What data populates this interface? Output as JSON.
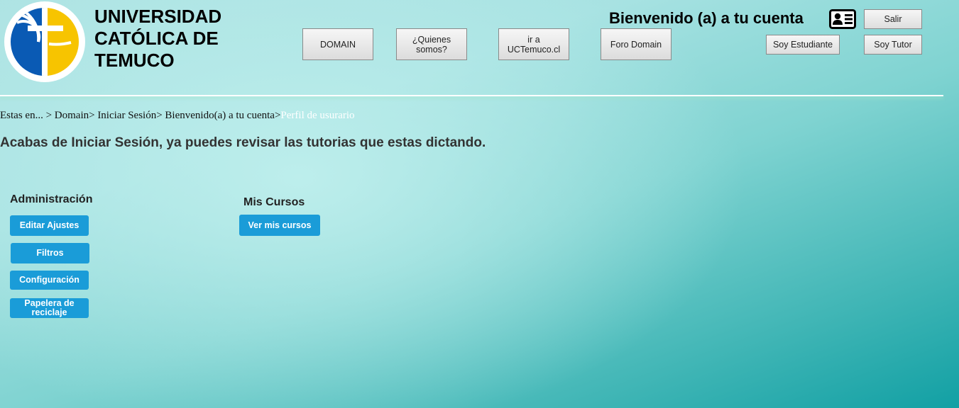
{
  "header": {
    "university_name_lines": [
      "UNIVERSIDAD",
      "CATÓLICA DE",
      "TEMUCO"
    ],
    "logo_icon": "university-shield-logo",
    "logo_colors": {
      "blue": "#0a5ab4",
      "yellow": "#f7c400",
      "white": "#ffffff"
    },
    "nav": {
      "domain": "DOMAIN",
      "quienes_line1": "¿Quienes",
      "quienes_line2": "somos?",
      "uctemuco_line1": "ir a",
      "uctemuco_line2": "UCTemuco.cl",
      "foro": "Foro Domain"
    },
    "welcome": "Bienvenido (a) a tu cuenta",
    "account_icon": "id-card-icon",
    "logout": "Salir",
    "student": "Soy Estudiante",
    "tutor": "Soy Tutor"
  },
  "breadcrumb": {
    "trail": "Estas en... > Domain> Iniciar Sesión> Bienvenido(a) a tu cuenta>",
    "current": "Perfil de usurario"
  },
  "main": {
    "headline": "Acabas de Iniciar Sesión, ya puedes revisar las tutorias que estas dictando."
  },
  "admin": {
    "title": "Administración",
    "edit_settings": "Editar Ajustes",
    "filters": "Filtros",
    "configuration": "Configuración",
    "recycle_line1": "Papelera de",
    "recycle_line2": "reciclaje"
  },
  "courses": {
    "title": "Mis Cursos",
    "view": "Ver mis cursos"
  },
  "colors": {
    "accent_button": "#1a9cd8",
    "breadcrumb_current": "#ffffff",
    "background_dark": "#12a0a4",
    "background_light": "#b9ecea"
  }
}
